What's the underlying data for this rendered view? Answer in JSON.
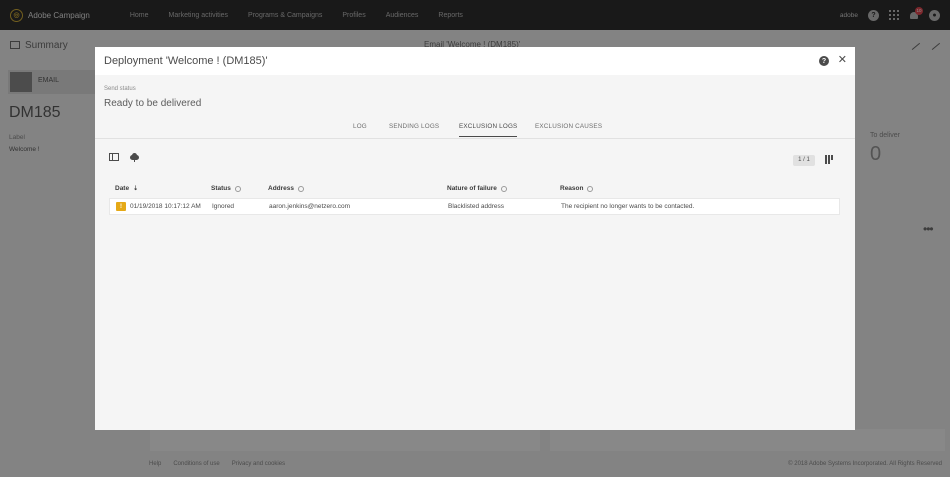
{
  "topnav": {
    "brand": "Adobe Campaign",
    "links": [
      "Home",
      "Marketing activities",
      "Programs & Campaigns",
      "Profiles",
      "Audiences",
      "Reports"
    ],
    "user": "adobe",
    "notification_count": "10"
  },
  "background": {
    "summary": "Summary",
    "email_title": "Email 'Welcome ! (DM185)'",
    "email_tab": "EMAIL",
    "code": "DM185",
    "label_caption": "Label",
    "label_value": "Welcome !",
    "to_deliver_label": "To deliver",
    "to_deliver_value": "0",
    "footer_links": [
      "Help",
      "Conditions of use",
      "Privacy and cookies"
    ],
    "copyright": "© 2018 Adobe Systems Incorporated. All Rights Reserved"
  },
  "modal": {
    "title": "Deployment 'Welcome ! (DM185)'",
    "send_status_label": "Send status",
    "send_status": "Ready to be delivered",
    "tabs": [
      {
        "label": "LOG"
      },
      {
        "label": "SENDING LOGS"
      },
      {
        "label": "EXCLUSION LOGS",
        "active": true
      },
      {
        "label": "EXCLUSION CAUSES"
      }
    ],
    "pager": "1 / 1",
    "columns": [
      "Date",
      "Status",
      "Address",
      "Nature of failure",
      "Reason"
    ],
    "rows": [
      {
        "date": "01/19/2018 10:17:12 AM",
        "status": "Ignored",
        "address": "aaron.jenkins@netzero.com",
        "failure": "Blacklisted address",
        "reason": "The recipient no longer wants to be contacted."
      }
    ]
  }
}
